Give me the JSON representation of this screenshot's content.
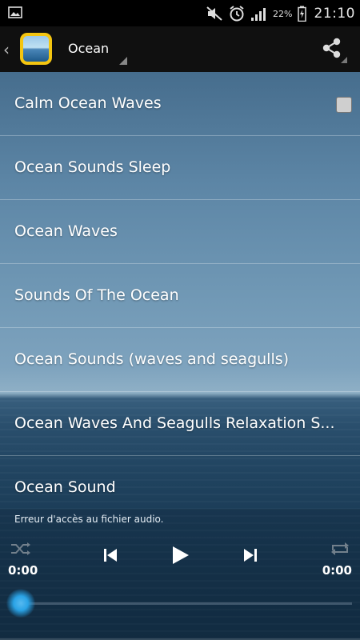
{
  "status_bar": {
    "battery_percent": "22%",
    "time": "21:10",
    "icons": [
      "gallery-icon",
      "mute-icon",
      "alarm-icon",
      "signal-icon",
      "battery-icon"
    ]
  },
  "action_bar": {
    "title": "Ocean",
    "icons": [
      "back-chevron-icon",
      "app-icon",
      "share-icon"
    ]
  },
  "list": {
    "items": [
      {
        "title": "Calm Ocean Waves",
        "checkbox": true
      },
      {
        "title": "Ocean Sounds Sleep"
      },
      {
        "title": "Ocean Waves"
      },
      {
        "title": "Sounds Of The Ocean"
      },
      {
        "title": "Ocean Sounds (waves and seagulls)"
      },
      {
        "title": "Ocean Waves And Seagulls Relaxation S..."
      },
      {
        "title": "Ocean Sound"
      }
    ]
  },
  "player": {
    "error": "Erreur d'accès au fichier audio.",
    "current_time": "0:00",
    "total_time": "0:00",
    "progress": 0,
    "icons": [
      "shuffle-icon",
      "previous-icon",
      "play-icon",
      "next-icon",
      "repeat-icon"
    ]
  },
  "colors": {
    "accent": "#2aa3e6",
    "icon_frame": "#f4c510"
  }
}
